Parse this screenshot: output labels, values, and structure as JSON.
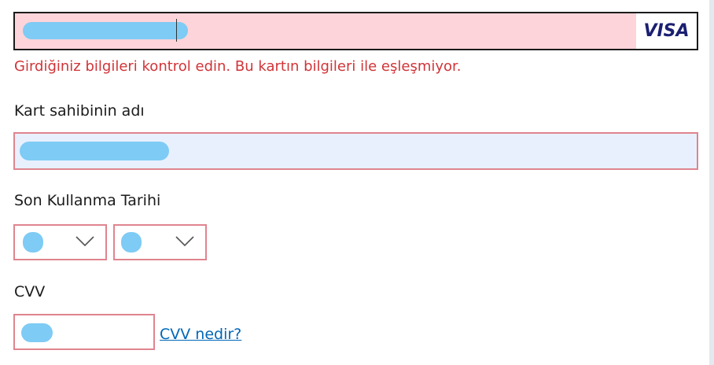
{
  "card_number": {
    "brand_logo": "VISA",
    "state": "error",
    "colors": {
      "background": "#fdd4d9",
      "border": "#1b1b1b",
      "redaction": "#7ecbf5"
    }
  },
  "error_message": "Girdiğiniz bilgileri kontrol edin. Bu kartın bilgileri ile eşleşmiyor.",
  "cardholder": {
    "label": "Kart sahibinin adı"
  },
  "expiry": {
    "label": "Son Kullanma Tarihi",
    "month_icon": "chevron-down-icon",
    "year_icon": "chevron-down-icon"
  },
  "cvv": {
    "label": "CVV",
    "help_link": "CVV nedir?"
  },
  "colors": {
    "error_text": "#d13438",
    "error_border": "#e0848e",
    "link": "#0067b8",
    "autofill_background": "#e8f0fe"
  }
}
